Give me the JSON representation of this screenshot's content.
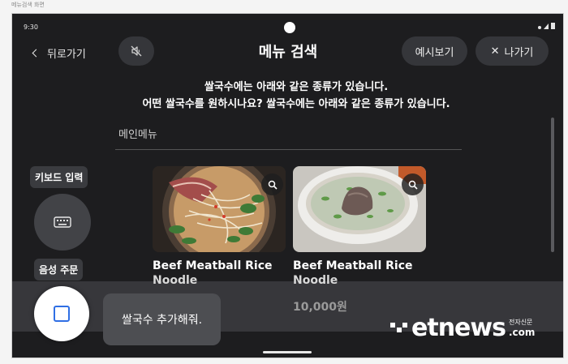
{
  "caption": "메뉴검색 화면",
  "status": {
    "time": "9:30"
  },
  "header": {
    "back_label": "뒤로가기",
    "title": "메뉴 검색",
    "preview_label": "예시보기",
    "exit_label": "나가기"
  },
  "prompt": {
    "line1": "쌀국수에는 아래와 같은 종류가 있습니다.",
    "line2": "어떤 쌀국수를 원하시나요? 쌀국수에는 아래와 같은 종류가 있습니다."
  },
  "section": {
    "title": "메인메뉴"
  },
  "side": {
    "keyboard_label": "키보드 입력",
    "voice_label": "음성 주문"
  },
  "menu_items": [
    {
      "name_line1": "Beef Meatball Rice",
      "name_line2": "Noodle"
    },
    {
      "name_line1": "Beef Meatball Rice",
      "name_line2": "Noodle",
      "price": "10,000원"
    }
  ],
  "voice": {
    "transcript": "쌀국수 추가해줘."
  },
  "watermark": {
    "logo": "etnews",
    "tagline": "전자신문",
    "domain": ".com"
  },
  "colors": {
    "background": "#1d1d1f",
    "pill": "#35363a",
    "accent": "#2f6fe4"
  }
}
